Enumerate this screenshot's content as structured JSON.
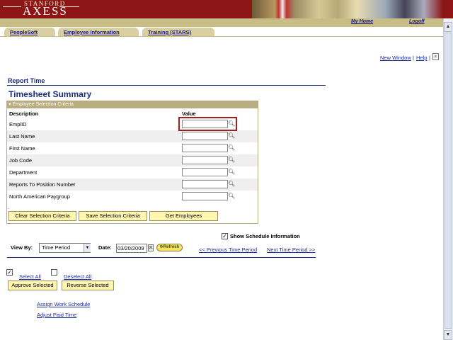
{
  "header": {
    "logo_top": "STANFORD",
    "logo_main": "AXESS",
    "nav_my_home": "My Home",
    "nav_logoff": "Logoff"
  },
  "tabs": [
    {
      "label": "PeopleSoft"
    },
    {
      "label": "Employee Information"
    },
    {
      "label": "Training (STARS)"
    }
  ],
  "top_links": {
    "new_window": "New Window",
    "sep": "|",
    "help": "Help",
    "sep2": "|"
  },
  "page": {
    "section": "Report Time",
    "title": "Timesheet Summary"
  },
  "criteria": {
    "panel_title": "Employee Selection Criteria",
    "col_description": "Description",
    "col_value": "Value",
    "rows": [
      {
        "label": "EmplID",
        "value": ""
      },
      {
        "label": "Last Name",
        "value": ""
      },
      {
        "label": "First Name",
        "value": ""
      },
      {
        "label": "Job Code",
        "value": ""
      },
      {
        "label": "Department",
        "value": ""
      },
      {
        "label": "Reports To Position Number",
        "value": ""
      },
      {
        "label": "North American Paygroup",
        "value": ""
      }
    ],
    "btn_clear": "Clear Selection Criteria",
    "btn_save": "Save Selection Criteria",
    "btn_get": "Get Employees"
  },
  "schedule": {
    "show_label": "Show Schedule Information",
    "checked": true
  },
  "view": {
    "label": "View By:",
    "selected": "Time Period",
    "date_label": "Date:",
    "date_value": "03/20/2009",
    "refresh": "Refresh",
    "prev": "<< Previous Time Period",
    "next": "Next Time Period >>"
  },
  "actions": {
    "select_all": "Select All",
    "deselect_all": "Deselect All",
    "approve": "Approve Selected",
    "reverse": "Reverse Selected",
    "assign_schedule": "Assign Work Schedule",
    "adjust_paid": "Adjust Paid Time"
  },
  "colors": {
    "banner": "#8c1515",
    "heading": "#1c2d80",
    "button": "#fff6b0"
  }
}
